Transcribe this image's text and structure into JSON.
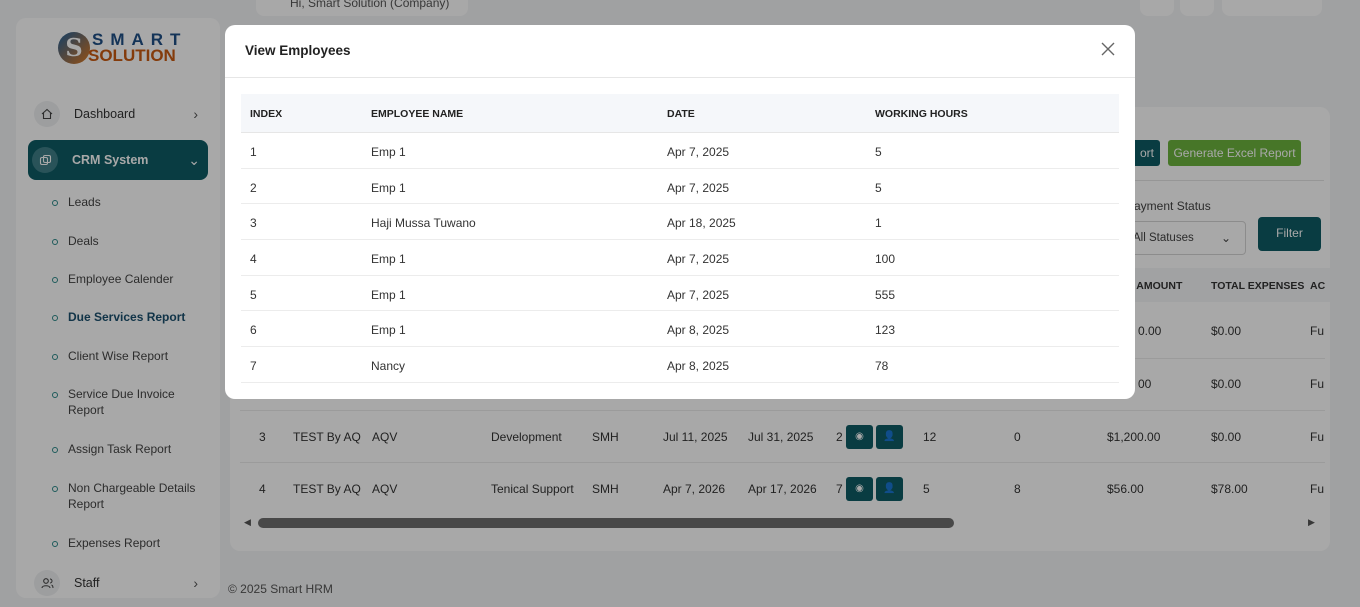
{
  "topbar": {
    "company": "Hi, Smart Solution (Company)"
  },
  "logo": {
    "line1": "SMART",
    "line2": "SOLUTION",
    "mark": "S"
  },
  "sidebar": {
    "dashboard": {
      "label": "Dashboard",
      "icon": "home-icon"
    },
    "crm": {
      "label": "CRM System",
      "icon": "crm-icon"
    },
    "items": [
      "Leads",
      "Deals",
      "Employee Calender",
      "Due Services Report",
      "Client Wise Report",
      "Service Due Invoice Report",
      "Assign Task Report",
      "Non Chargeable Details Report",
      "Expenses Report"
    ],
    "active_item": "Due Services Report",
    "staff": {
      "label": "Staff",
      "icon": "users-icon"
    }
  },
  "background": {
    "export_btn_fragment": "ort",
    "excel_btn": "Generate Excel Report",
    "filter_label": "Payment Status",
    "filter_select": "All Statuses",
    "filter_btn": "Filter",
    "headers": [
      "NG AMOUNT",
      "TOTAL EXPENSES",
      "AC"
    ],
    "rows": [
      {
        "amount": "0.00",
        "expenses": "$0.00",
        "act": "Fu"
      },
      {
        "amount": "00",
        "expenses": "$0.00",
        "act": "Fu"
      },
      {
        "index": "3",
        "name": "TEST By AQ",
        "client": "AQV",
        "service": "Development",
        "branch": "SMH",
        "start": "Jul 11, 2025",
        "end": "Jul 31, 2025",
        "count": "2",
        "a": "12",
        "b": "0",
        "amount": "$1,200.00",
        "expenses": "$0.00",
        "act": "Fu"
      },
      {
        "index": "4",
        "name": "TEST By AQ",
        "client": "AQV",
        "service": "Tenical Support",
        "branch": "SMH",
        "start": "Apr 7, 2026",
        "end": "Apr 17, 2026",
        "count": "7",
        "a": "5",
        "b": "8",
        "amount": "$56.00",
        "expenses": "$78.00",
        "act": "Fu"
      }
    ]
  },
  "footer": "© 2025 Smart HRM",
  "modal": {
    "title": "View Employees",
    "columns": [
      "INDEX",
      "EMPLOYEE NAME",
      "DATE",
      "WORKING HOURS"
    ],
    "rows": [
      {
        "index": "1",
        "name": "Emp 1",
        "date": "Apr 7, 2025",
        "hours": "5"
      },
      {
        "index": "2",
        "name": "Emp 1",
        "date": "Apr 7, 2025",
        "hours": "5"
      },
      {
        "index": "3",
        "name": "Haji Mussa Tuwano",
        "date": "Apr 18, 2025",
        "hours": "1"
      },
      {
        "index": "4",
        "name": "Emp 1",
        "date": "Apr 7, 2025",
        "hours": "100"
      },
      {
        "index": "5",
        "name": "Emp 1",
        "date": "Apr 7, 2025",
        "hours": "555"
      },
      {
        "index": "6",
        "name": "Emp 1",
        "date": "Apr 8, 2025",
        "hours": "123"
      },
      {
        "index": "7",
        "name": "Nancy",
        "date": "Apr 8, 2025",
        "hours": "78"
      }
    ]
  },
  "colors": {
    "primary": "#0e5b64",
    "excel": "#6db43e"
  }
}
